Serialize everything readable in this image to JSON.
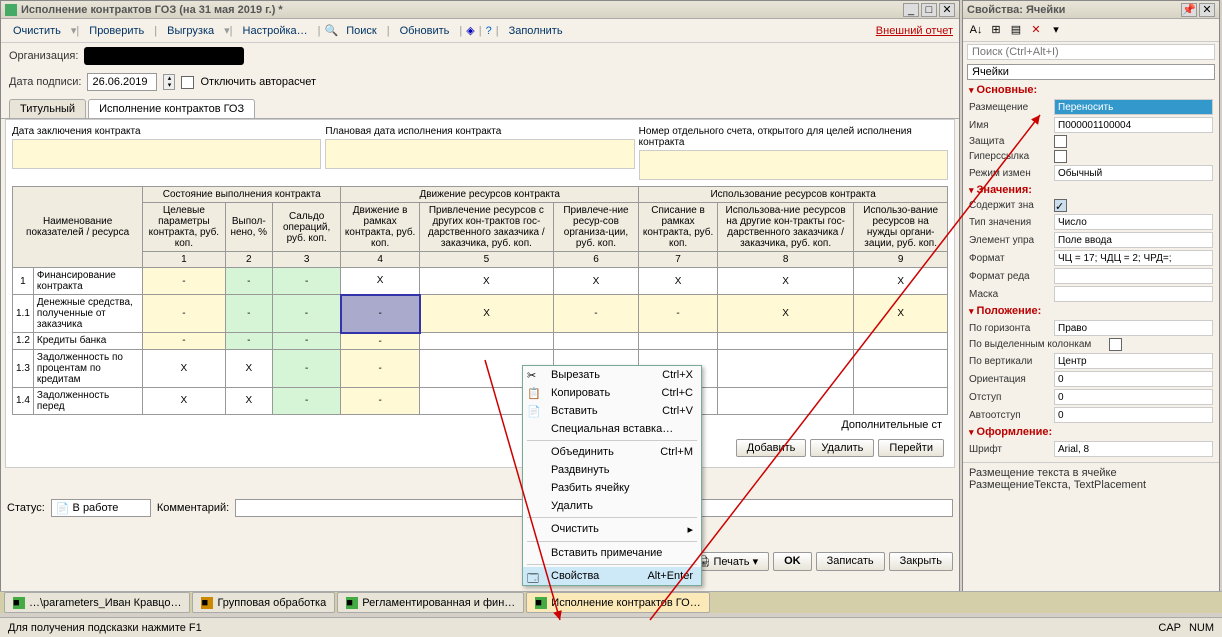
{
  "main": {
    "title": "Исполнение контрактов ГОЗ (на 31 мая 2019 г.) *",
    "toolbar": {
      "clear": "Очистить",
      "check": "Проверить",
      "export": "Выгрузка",
      "settings": "Настройка…",
      "search": "Поиск",
      "refresh": "Обновить",
      "fill": "Заполнить",
      "external": "Внешний отчет"
    },
    "org_label": "Организация:",
    "date_label": "Дата подписи:",
    "date_value": "26.06.2019",
    "autocalc": "Отключить авторасчет",
    "tabs": {
      "title": "Титульный",
      "exec": "Исполнение контрактов ГОЗ"
    },
    "info": {
      "h1": "Дата заключения контракта",
      "h2": "Плановая дата исполнения контракта",
      "h3": "Номер отдельного счета, открытого для целей исполнения контракта"
    },
    "table": {
      "group1": "Состояние выполнения контракта",
      "group2": "Движение ресурсов контракта",
      "group3": "Использование ресурсов контракта",
      "rowhead": "Наименование показателей / ресурса",
      "c1": "Целевые параметры контракта, руб. коп.",
      "c2": "Выпол-\nнено, %",
      "c3": "Сальдо операций, руб. коп.",
      "c4": "Движение в рамках контракта, руб. коп.",
      "c5": "Привлечение ресурсов с других кон-трактов гос-дарственного заказчика / заказчика, руб. коп.",
      "c6": "Привлече-ние ресур-сов организа-ции, руб. коп.",
      "c7": "Списание в рамках контракта, руб. коп.",
      "c8": "Использова-ние ресурсов на другие кон-тракты гос-дарственного заказчика / заказчика, руб. коп.",
      "c9": "Использо-вание ресурсов на нужды органи-зации, руб. коп.",
      "n1": "1",
      "n2": "2",
      "n3": "3",
      "n4": "4",
      "n5": "5",
      "n6": "6",
      "n7": "7",
      "n8": "8",
      "n9": "9",
      "r1_no": "1",
      "r1": "Финансирование контракта",
      "r11_no": "1.1",
      "r11": "Денежные средства, полученные от заказчика",
      "r12_no": "1.2",
      "r12": "Кредиты банка",
      "r13_no": "1.3",
      "r13": "Задолженность по процентам по кредитам",
      "r14_no": "1.4",
      "r14": "Задолженность перед"
    },
    "x": "X",
    "dash": "-",
    "add_info": "Дополнительные ст",
    "add": "Добавить",
    "delete": "Удалить",
    "goto": "Перейти",
    "status_label": "Статус:",
    "status_value": "В работе",
    "comment_label": "Комментарий:",
    "print": "Печать",
    "ok": "OK",
    "save": "Записать",
    "close": "Закрыть"
  },
  "ctx": {
    "cut": "Вырезать",
    "cut_k": "Ctrl+X",
    "copy": "Копировать",
    "copy_k": "Ctrl+C",
    "paste": "Вставить",
    "paste_k": "Ctrl+V",
    "spec": "Специальная вставка…",
    "merge": "Объединить",
    "merge_k": "Ctrl+M",
    "expand": "Раздвинуть",
    "split": "Разбить ячейку",
    "del": "Удалить",
    "clr": "Очистить",
    "note": "Вставить примечание",
    "props": "Свойства",
    "props_k": "Alt+Enter"
  },
  "tasks": {
    "t1": "…\\parameters_Иван Кравцо…",
    "t2": "Групповая обработка",
    "t3": "Регламентированная и фин…",
    "t4": "Исполнение контрактов ГО…"
  },
  "statusbar": {
    "hint": "Для получения подсказки нажмите F1",
    "cap": "CAP",
    "num": "NUM"
  },
  "props": {
    "title": "Свойства: Ячейки",
    "search_ph": "Поиск (Ctrl+Alt+I)",
    "cat": "Ячейки",
    "sec_main": "Основные:",
    "placement": "Размещение",
    "placement_v": "Переносить",
    "name": "Имя",
    "name_v": "П000001100004",
    "protect": "Защита",
    "link": "Гиперссылка",
    "editmode": "Режим измен",
    "editmode_v": "Обычный",
    "sec_val": "Значения:",
    "contains": "Содержит зна",
    "valtype": "Тип значения",
    "valtype_v": "Число",
    "ctrl": "Элемент упра",
    "ctrl_v": "Поле ввода",
    "format": "Формат",
    "format_v": "ЧЦ = 17; ЧДЦ = 2; ЧРД=;",
    "editfmt": "Формат реда",
    "mask": "Маска",
    "sec_pos": "Положение:",
    "halign": "По горизонта",
    "halign_v": "Право",
    "bysel": "По выделенным колонкам",
    "valign": "По вертикали",
    "valign_v": "Центр",
    "orient": "Ориентация",
    "orient_v": "0",
    "indent": "Отступ",
    "indent_v": "0",
    "auto": "Автоотступ",
    "auto_v": "0",
    "sec_design": "Оформление:",
    "font": "Шрифт",
    "font_v": "Arial, 8",
    "desc1": "Размещение текста в ячейке",
    "desc2": "РазмещениеТекста, TextPlacement"
  }
}
